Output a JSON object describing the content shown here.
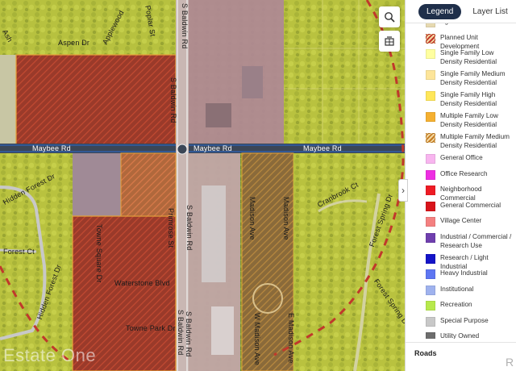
{
  "map": {
    "watermark": "Estate One",
    "streets": {
      "aspen": "Aspen Dr",
      "applewood": "Applewood",
      "poplar": "Poplar St",
      "ash": "Ash",
      "baldwin1": "S Baldwin Rd",
      "baldwin2": "S Baldwin Rd",
      "baldwin3": "S Baldwin Rd",
      "baldwin4": "S Baldwin Rd",
      "baldwin5": "S Baldwin Rd",
      "maybee1": "Maybee Rd",
      "maybee2": "Maybee Rd",
      "maybee3": "Maybee Rd",
      "madison1": "Madison Ave",
      "madison2": "Madison Ave",
      "madison3": "W Madison Ave",
      "madison4": "E Madison Ave",
      "waterstone": "Waterstone Blvd",
      "towne_square": "Towne Square Dr",
      "towne_park": "Towne Park Dr",
      "primrose": "Primrose St",
      "hidden_forest1": "Hidden Forest Dr",
      "hidden_forest2": "Hidden Forest Dr",
      "forest_ct": "Forest Ct",
      "cranbrook": "Cranbrook Ct",
      "forest_spring": "Forest Spring Dr",
      "forest_spring2": "Forest Spring Dr"
    },
    "buttons": {
      "search_icon": "search-icon",
      "basemap_icon": "basemap-icon"
    }
  },
  "panel": {
    "tabs": [
      {
        "label": "Legend",
        "active": true
      },
      {
        "label": "Layer List",
        "active": false
      }
    ],
    "collapse_glyph": "›",
    "legend": [
      {
        "label": "Agricultural / Rural",
        "color": "#e6d9b0"
      },
      {
        "label": "Planned Unit Development",
        "color": "#c2332a"
      },
      {
        "label": "Single Family Low Density Residential",
        "color": "#ffffa0"
      },
      {
        "label": "Single Family Medium Density Residential",
        "color": "#fde59a"
      },
      {
        "label": "Single Family High Density Residential",
        "color": "#ffe75a"
      },
      {
        "label": "Multiple Family Low Density Residential",
        "color": "#f5b031"
      },
      {
        "label": "Multiple Family Medium Density Residential",
        "color": "#c57b22"
      },
      {
        "label": "General Office",
        "color": "#f8b5ef"
      },
      {
        "label": "Office Research",
        "color": "#ee2ee2"
      },
      {
        "label": "Neighborhood Commercial",
        "color": "#ee1b24"
      },
      {
        "label": "General Commercial",
        "color": "#d8141b"
      },
      {
        "label": "Village Center",
        "color": "#f48080"
      },
      {
        "label": "Industrial / Commercial / Research Use",
        "color": "#6f3fae"
      },
      {
        "label": "Research / Light Industrial",
        "color": "#1414c8"
      },
      {
        "label": "Heavy Industrial",
        "color": "#5e76f2"
      },
      {
        "label": "Institutional",
        "color": "#9fb2ee"
      },
      {
        "label": "Recreation",
        "color": "#b7e94c"
      },
      {
        "label": "Special Purpose",
        "color": "#c8c8c8"
      },
      {
        "label": "Utility Owned",
        "color": "#6d6d6d"
      }
    ],
    "roads_title": "Roads",
    "roads_cut": "R"
  }
}
